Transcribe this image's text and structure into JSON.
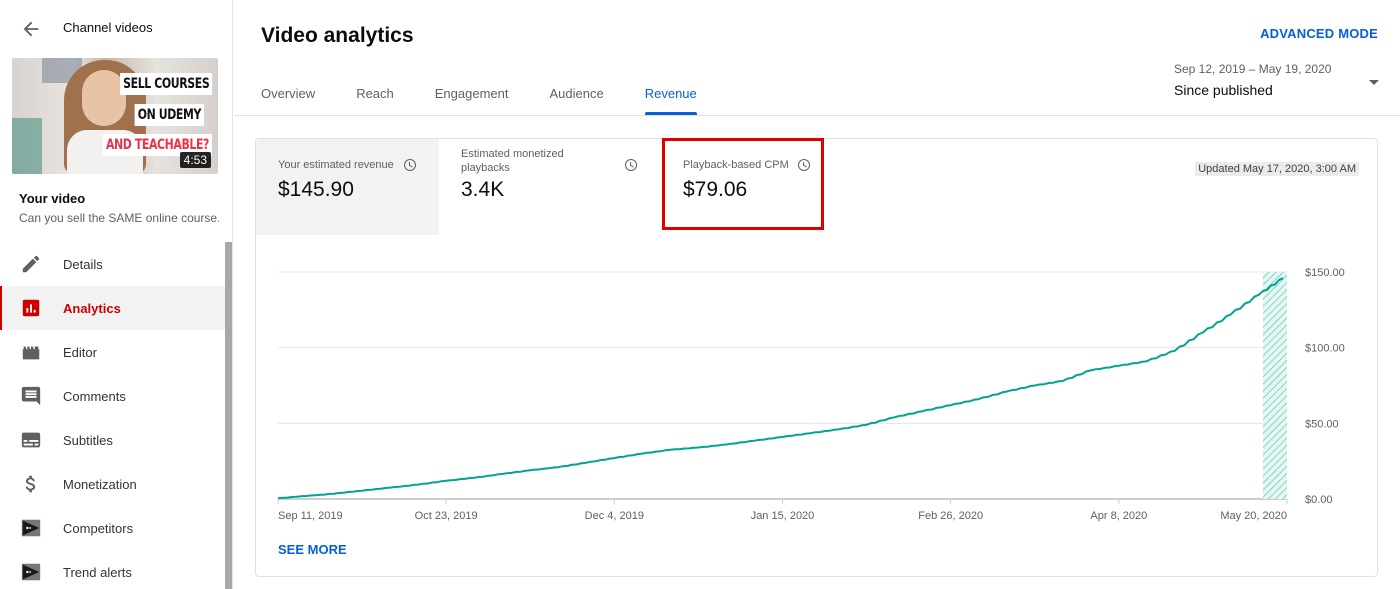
{
  "sidebar": {
    "back_label": "Channel videos",
    "thumbnail": {
      "lines": [
        "SELL COURSES",
        "ON UDEMY",
        "AND TEACHABLE?"
      ],
      "duration": "4:53"
    },
    "your_video_label": "Your video",
    "video_title": "Can you sell the SAME online course...",
    "items": [
      {
        "label": "Details",
        "icon": "pencil-icon",
        "active": false
      },
      {
        "label": "Analytics",
        "icon": "analytics-icon",
        "active": true
      },
      {
        "label": "Editor",
        "icon": "clapperboard-icon",
        "active": false
      },
      {
        "label": "Comments",
        "icon": "comment-icon",
        "active": false
      },
      {
        "label": "Subtitles",
        "icon": "subtitles-icon",
        "active": false
      },
      {
        "label": "Monetization",
        "icon": "dollar-icon",
        "active": false
      },
      {
        "label": "Competitors",
        "icon": "vidiq-icon",
        "active": false
      },
      {
        "label": "Trend alerts",
        "icon": "vidiq-icon",
        "active": false
      }
    ]
  },
  "header": {
    "title": "Video analytics",
    "advanced_mode": "ADVANCED MODE",
    "tabs": [
      {
        "label": "Overview",
        "active": false
      },
      {
        "label": "Reach",
        "active": false
      },
      {
        "label": "Engagement",
        "active": false
      },
      {
        "label": "Audience",
        "active": false
      },
      {
        "label": "Revenue",
        "active": true
      }
    ],
    "date_range": "Sep 12, 2019 – May 19, 2020",
    "date_label": "Since published"
  },
  "metrics": [
    {
      "label": "Your estimated revenue",
      "value": "$145.90",
      "selected": true
    },
    {
      "label": "Estimated monetized playbacks",
      "value": "3.4K",
      "selected": false
    },
    {
      "label": "Playback-based CPM",
      "value": "$79.06",
      "selected": false,
      "highlighted": true
    }
  ],
  "updated_text": "Updated May 17, 2020, 3:00 AM",
  "see_more": "SEE MORE",
  "colors": {
    "accent": "#065fd4",
    "active_nav": "#cc0000",
    "line": "#00a48f",
    "highlight_box": "#e10000"
  },
  "chart_data": {
    "type": "line",
    "title": "",
    "xlabel": "",
    "ylabel": "",
    "series": [
      {
        "name": "Your estimated revenue (cumulative)",
        "x_days_since_start": [
          0,
          7,
          14,
          21,
          28,
          35,
          42,
          49,
          56,
          63,
          70,
          77,
          84,
          91,
          98,
          105,
          112,
          119,
          126,
          133,
          140,
          147,
          154,
          161,
          168,
          175,
          182,
          189,
          196,
          203,
          210,
          217,
          224,
          231,
          238,
          245,
          251
        ],
        "values": [
          0.5,
          2,
          3.5,
          5.5,
          7.5,
          9.5,
          12,
          14,
          16.5,
          19,
          21,
          24,
          27,
          30,
          32.5,
          34,
          36,
          38.5,
          41,
          43.5,
          46,
          49,
          54,
          58,
          62,
          66,
          71,
          75,
          78,
          85,
          88,
          91,
          98,
          110,
          122,
          135,
          145.9
        ]
      }
    ],
    "x_start_date": "Sep 11, 2019",
    "x_tick_labels": [
      "Sep 11, 2019",
      "Oct 23, 2019",
      "Dec 4, 2019",
      "Jan 15, 2020",
      "Feb 26, 2020",
      "Apr 8, 2020",
      "May 20, 2020"
    ],
    "x_tick_days": [
      0,
      42,
      84,
      126,
      168,
      210,
      252
    ],
    "y_tick_labels": [
      "$0.00",
      "$50.00",
      "$100.00",
      "$150.00"
    ],
    "y_ticks": [
      0,
      50,
      100,
      150
    ],
    "ylim": [
      0,
      150
    ],
    "xlim_days": [
      0,
      252
    ],
    "estimated_region_days": [
      246,
      252
    ],
    "grid": true,
    "y_axis_side": "right"
  }
}
